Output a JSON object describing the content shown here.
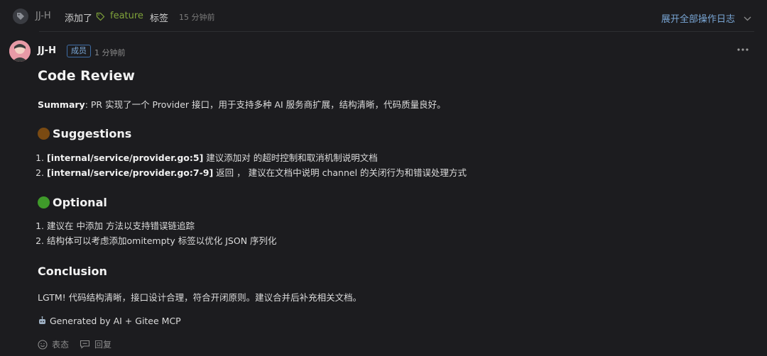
{
  "activity": {
    "user": "JJ-H",
    "action": "添加了",
    "label": "feature",
    "suffix": "标签",
    "time": "15 分钟前",
    "expand_log": "展开全部操作日志"
  },
  "comment": {
    "author": "JJ-H",
    "role": "成员",
    "time": "1 分钟前",
    "title": "Code Review",
    "summary_label": "Summary",
    "summary_text": ": PR 实现了一个 Provider 接口，用于支持多种 AI 服务商扩展，结构清晰，代码质量良好。",
    "suggestions": {
      "title": "Suggestions",
      "items": [
        {
          "path": "[internal/service/provider.go:5]",
          "text": " 建议添加对 的超时控制和取消机制说明文档"
        },
        {
          "path": "[internal/service/provider.go:7-9]",
          "text": " 返回 ， 建议在文档中说明 channel 的关闭行为和错误处理方式"
        }
      ]
    },
    "optional": {
      "title": "Optional",
      "items": [
        "建议在 中添加 方法以支持错误链追踪",
        "结构体可以考虑添加omitempty 标签以优化 JSON 序列化"
      ]
    },
    "conclusion": {
      "title": "Conclusion",
      "text": "LGTM! 代码结构清晰，接口设计合理，符合开闭原则。建议合并后补充相关文档。"
    },
    "generated_by": "Generated by AI + Gitee MCP"
  },
  "footer": {
    "react_label": "表态",
    "reply_label": "回复"
  },
  "colors": {
    "background": "#1c1c1f",
    "label_green": "#7fa23a",
    "link_blue": "#7aa7d6",
    "suggestion_dot": "#7a4a12",
    "optional_dot": "#3f9a2a"
  },
  "icons": [
    "tag-icon",
    "chevron-down-icon",
    "more-icon",
    "robot-icon",
    "smile-icon",
    "comment-icon"
  ]
}
